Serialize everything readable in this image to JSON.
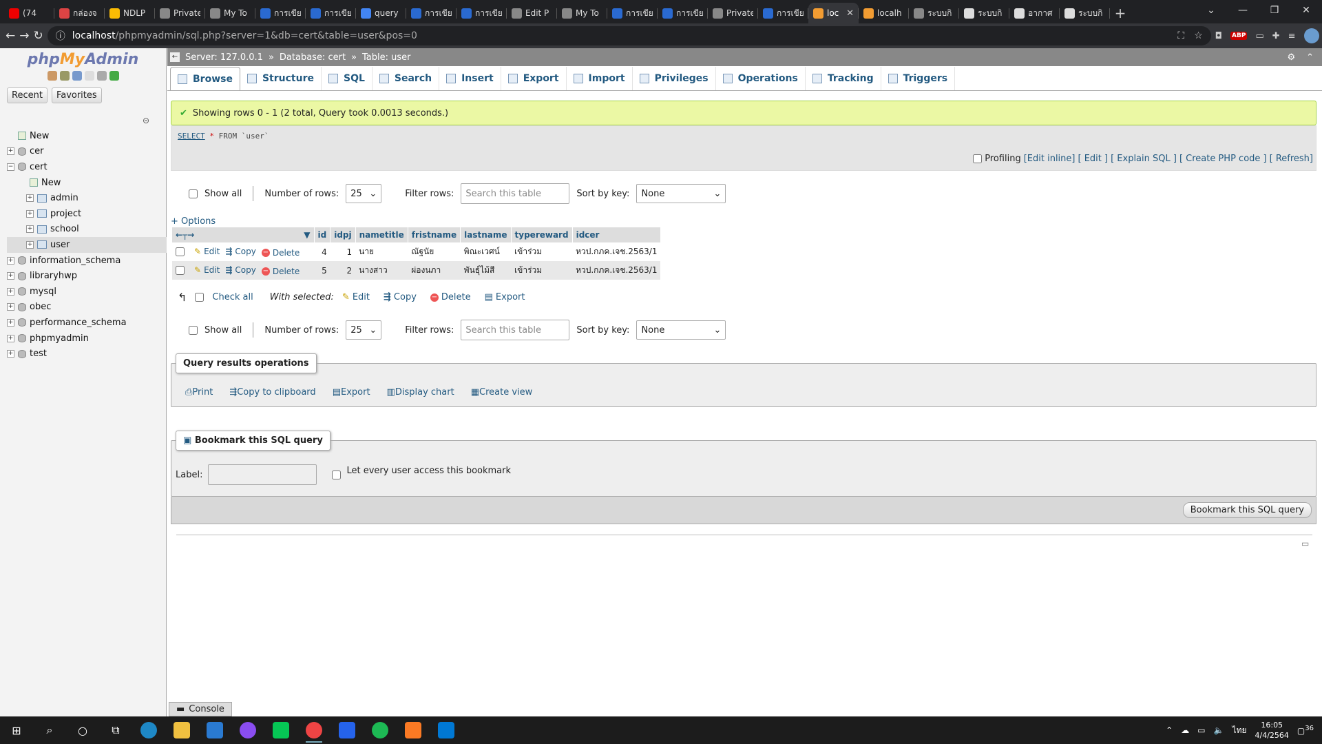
{
  "browser": {
    "tabs": [
      {
        "title": "(74",
        "color": "#e00",
        "active": false
      },
      {
        "title": "กล่องจ",
        "color": "#d44",
        "active": false
      },
      {
        "title": "NDLP",
        "color": "#fbbc04",
        "active": false
      },
      {
        "title": "Private",
        "color": "#888",
        "active": false
      },
      {
        "title": "My To",
        "color": "#888",
        "active": false
      },
      {
        "title": "การเขียน",
        "color": "#2a6ad1",
        "active": false
      },
      {
        "title": "การเขีย",
        "color": "#2a6ad1",
        "active": false
      },
      {
        "title": "query",
        "color": "#4285f4",
        "active": false
      },
      {
        "title": "การเขีย",
        "color": "#2a6ad1",
        "active": false
      },
      {
        "title": "การเขีย",
        "color": "#2a6ad1",
        "active": false
      },
      {
        "title": "Edit P",
        "color": "#888",
        "active": false
      },
      {
        "title": "My To",
        "color": "#888",
        "active": false
      },
      {
        "title": "การเขีย",
        "color": "#2a6ad1",
        "active": false
      },
      {
        "title": "การเขีย",
        "color": "#2a6ad1",
        "active": false
      },
      {
        "title": "Private",
        "color": "#888",
        "active": false
      },
      {
        "title": "การเขีย",
        "color": "#2a6ad1",
        "active": false
      },
      {
        "title": "loc",
        "color": "#f29c32",
        "active": true
      },
      {
        "title": "localh",
        "color": "#f29c32",
        "active": false
      },
      {
        "title": "ระบบกิ",
        "color": "#888",
        "active": false
      },
      {
        "title": "ระบบกิ",
        "color": "#ddd",
        "active": false
      },
      {
        "title": "อากาศ",
        "color": "#ddd",
        "active": false
      },
      {
        "title": "ระบบกิ",
        "color": "#ddd",
        "active": false
      }
    ],
    "url_host": "localhost",
    "url_path": "/phpmyadmin/sql.php?server=1&db=cert&table=user&pos=0"
  },
  "nav": {
    "logo_php": "php",
    "logo_my": "My",
    "logo_admin": "Admin",
    "recent": "Recent",
    "favorites": "Favorites",
    "tree": [
      {
        "label": "New",
        "level": 0,
        "kind": "new"
      },
      {
        "label": "cer",
        "level": 0,
        "kind": "db"
      },
      {
        "label": "cert",
        "level": 0,
        "kind": "db"
      },
      {
        "label": "New",
        "level": 1,
        "kind": "new"
      },
      {
        "label": "admin",
        "level": 1,
        "kind": "tbl"
      },
      {
        "label": "project",
        "level": 1,
        "kind": "tbl"
      },
      {
        "label": "school",
        "level": 1,
        "kind": "tbl"
      },
      {
        "label": "user",
        "level": 1,
        "kind": "tbl"
      },
      {
        "label": "information_schema",
        "level": 0,
        "kind": "db"
      },
      {
        "label": "libraryhwp",
        "level": 0,
        "kind": "db"
      },
      {
        "label": "mysql",
        "level": 0,
        "kind": "db"
      },
      {
        "label": "obec",
        "level": 0,
        "kind": "db"
      },
      {
        "label": "performance_schema",
        "level": 0,
        "kind": "db"
      },
      {
        "label": "phpmyadmin",
        "level": 0,
        "kind": "db"
      },
      {
        "label": "test",
        "level": 0,
        "kind": "db"
      }
    ]
  },
  "breadcrumb": {
    "server": "Server: 127.0.0.1",
    "database": "Database: cert",
    "table": "Table: user",
    "sep": "»"
  },
  "tabs": [
    "Browse",
    "Structure",
    "SQL",
    "Search",
    "Insert",
    "Export",
    "Import",
    "Privileges",
    "Operations",
    "Tracking",
    "Triggers"
  ],
  "message": "Showing rows 0 - 1 (2 total, Query took 0.0013 seconds.)",
  "sql": {
    "select": "SELECT",
    "star": "*",
    "from": "FROM",
    "table": "`user`"
  },
  "profiling": {
    "label": "Profiling",
    "links": [
      "[Edit inline]",
      "[ Edit ]",
      "[ Explain SQL ]",
      "[ Create PHP code ]",
      "[ Refresh]"
    ]
  },
  "controls": {
    "show_all": "Show all",
    "number_of_rows": "Number of rows:",
    "rows_value": "25",
    "filter_rows": "Filter rows:",
    "filter_placeholder": "Search this table",
    "sort_by_key": "Sort by key:",
    "sort_value": "None"
  },
  "options_label": "+ Options",
  "table": {
    "columns": [
      "id",
      "idpj",
      "nametitle",
      "fristname",
      "lastname",
      "typereward",
      "idcer"
    ],
    "rows": [
      [
        "4",
        "1",
        "นาย",
        "ณัฐนัย",
        "พิณะเวศน์",
        "เข้าร่วม",
        "หวป.กภค.เจช.2563/1"
      ],
      [
        "5",
        "2",
        "นางสาว",
        "ผ่องนภา",
        "พันธุ์ไม้สี",
        "เข้าร่วม",
        "หวป.กภค.เจช.2563/1"
      ]
    ],
    "row_actions": {
      "edit": "Edit",
      "copy": "Copy",
      "delete": "Delete"
    }
  },
  "with_selected": {
    "check_all": "Check all",
    "label": "With selected:",
    "edit": "Edit",
    "copy": "Copy",
    "delete": "Delete",
    "export": "Export"
  },
  "qro": {
    "title": "Query results operations",
    "print": "Print",
    "copy_clipboard": "Copy to clipboard",
    "export": "Export",
    "display_chart": "Display chart",
    "create_view": "Create view"
  },
  "bookmark": {
    "title": "Bookmark this SQL query",
    "label": "Label:",
    "let_every": "Let every user access this bookmark",
    "button": "Bookmark this SQL query"
  },
  "console": "Console",
  "taskbar": {
    "time": "16:05",
    "date": "4/4/2564",
    "lang": "ไทย",
    "notif": "36"
  }
}
